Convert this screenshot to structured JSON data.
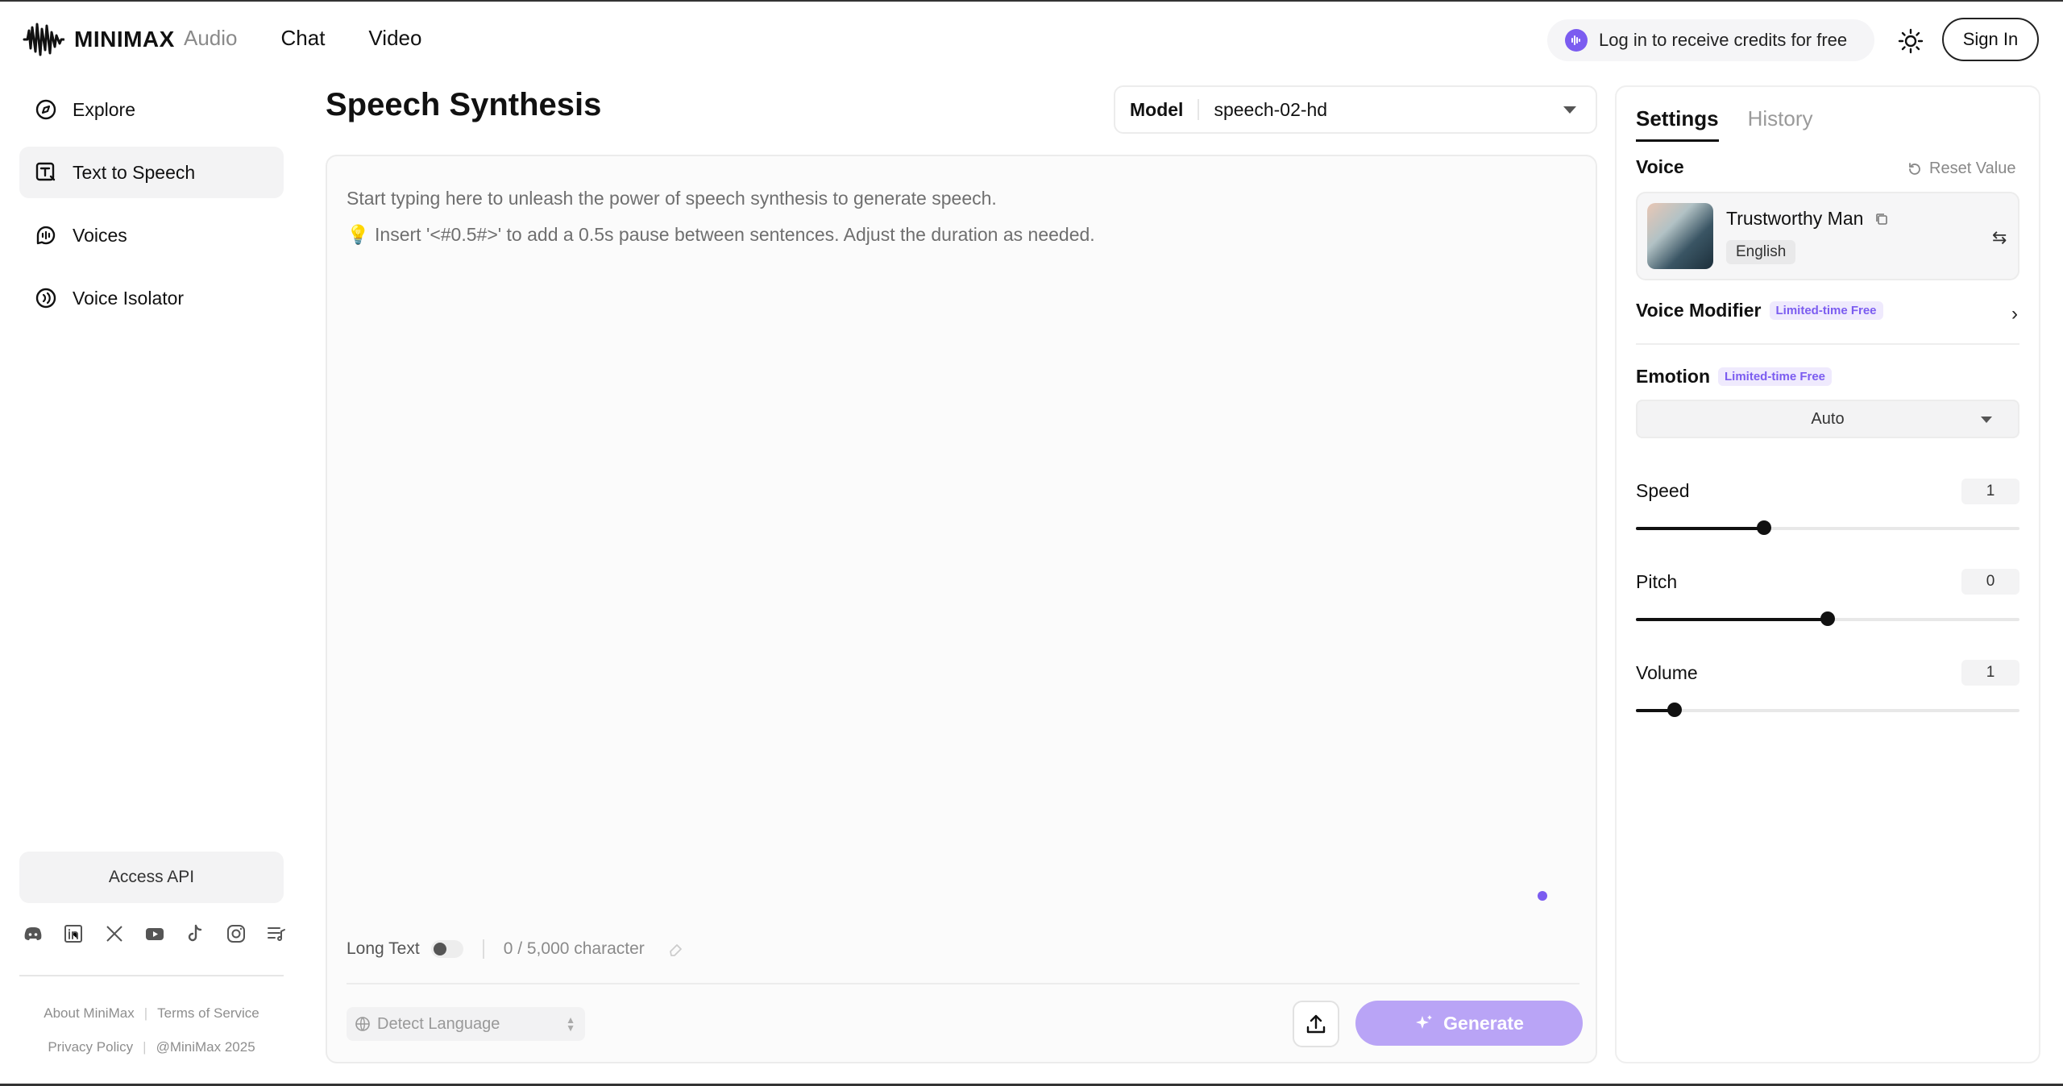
{
  "header": {
    "brand": "MINIMAX",
    "nav": [
      "Audio",
      "Chat",
      "Video"
    ],
    "credits_text": "Log in to receive credits for free",
    "signin_label": "Sign In",
    "accent": "#7b5cf0"
  },
  "sidebar": {
    "items": [
      {
        "label": "Explore",
        "icon": "compass-icon"
      },
      {
        "label": "Text to Speech",
        "icon": "text-to-speech-icon"
      },
      {
        "label": "Voices",
        "icon": "voices-icon"
      },
      {
        "label": "Voice Isolator",
        "icon": "voice-isolator-icon"
      }
    ],
    "access_api": "Access API",
    "socials": [
      "discord-icon",
      "linkedin-icon",
      "x-icon",
      "youtube-icon",
      "tiktok-icon",
      "instagram-icon",
      "playlist-icon"
    ],
    "footer": {
      "about": "About MiniMax",
      "terms": "Terms of Service",
      "privacy": "Privacy Policy",
      "copyright": "@MiniMax 2025",
      "separator": "|"
    }
  },
  "main": {
    "title": "Speech Synthesis",
    "model_label": "Model",
    "model_value": "speech-02-hd",
    "placeholder_line1": "Start typing here to unleash the power of speech synthesis to generate speech.",
    "placeholder_line2": "Insert '<#0.5#>' to add a 0.5s pause between sentences. Adjust the duration as needed.",
    "bulb": "💡",
    "long_text_label": "Long Text",
    "char_count": "0 / 5,000 character",
    "detect_language": "Detect Language",
    "generate_label": "Generate"
  },
  "panel": {
    "tabs": [
      "Settings",
      "History"
    ],
    "voice_label": "Voice",
    "reset_label": "Reset Value",
    "voice_name": "Trustworthy Man",
    "voice_language": "English",
    "voice_modifier_label": "Voice Modifier",
    "emotion_label": "Emotion",
    "limited_badge": "Limited-time Free",
    "emotion_value": "Auto",
    "speed": {
      "label": "Speed",
      "value": "1",
      "fraction": 0.333
    },
    "pitch": {
      "label": "Pitch",
      "value": "0",
      "fraction": 0.5
    },
    "volume": {
      "label": "Volume",
      "value": "1",
      "fraction": 0.1
    }
  }
}
